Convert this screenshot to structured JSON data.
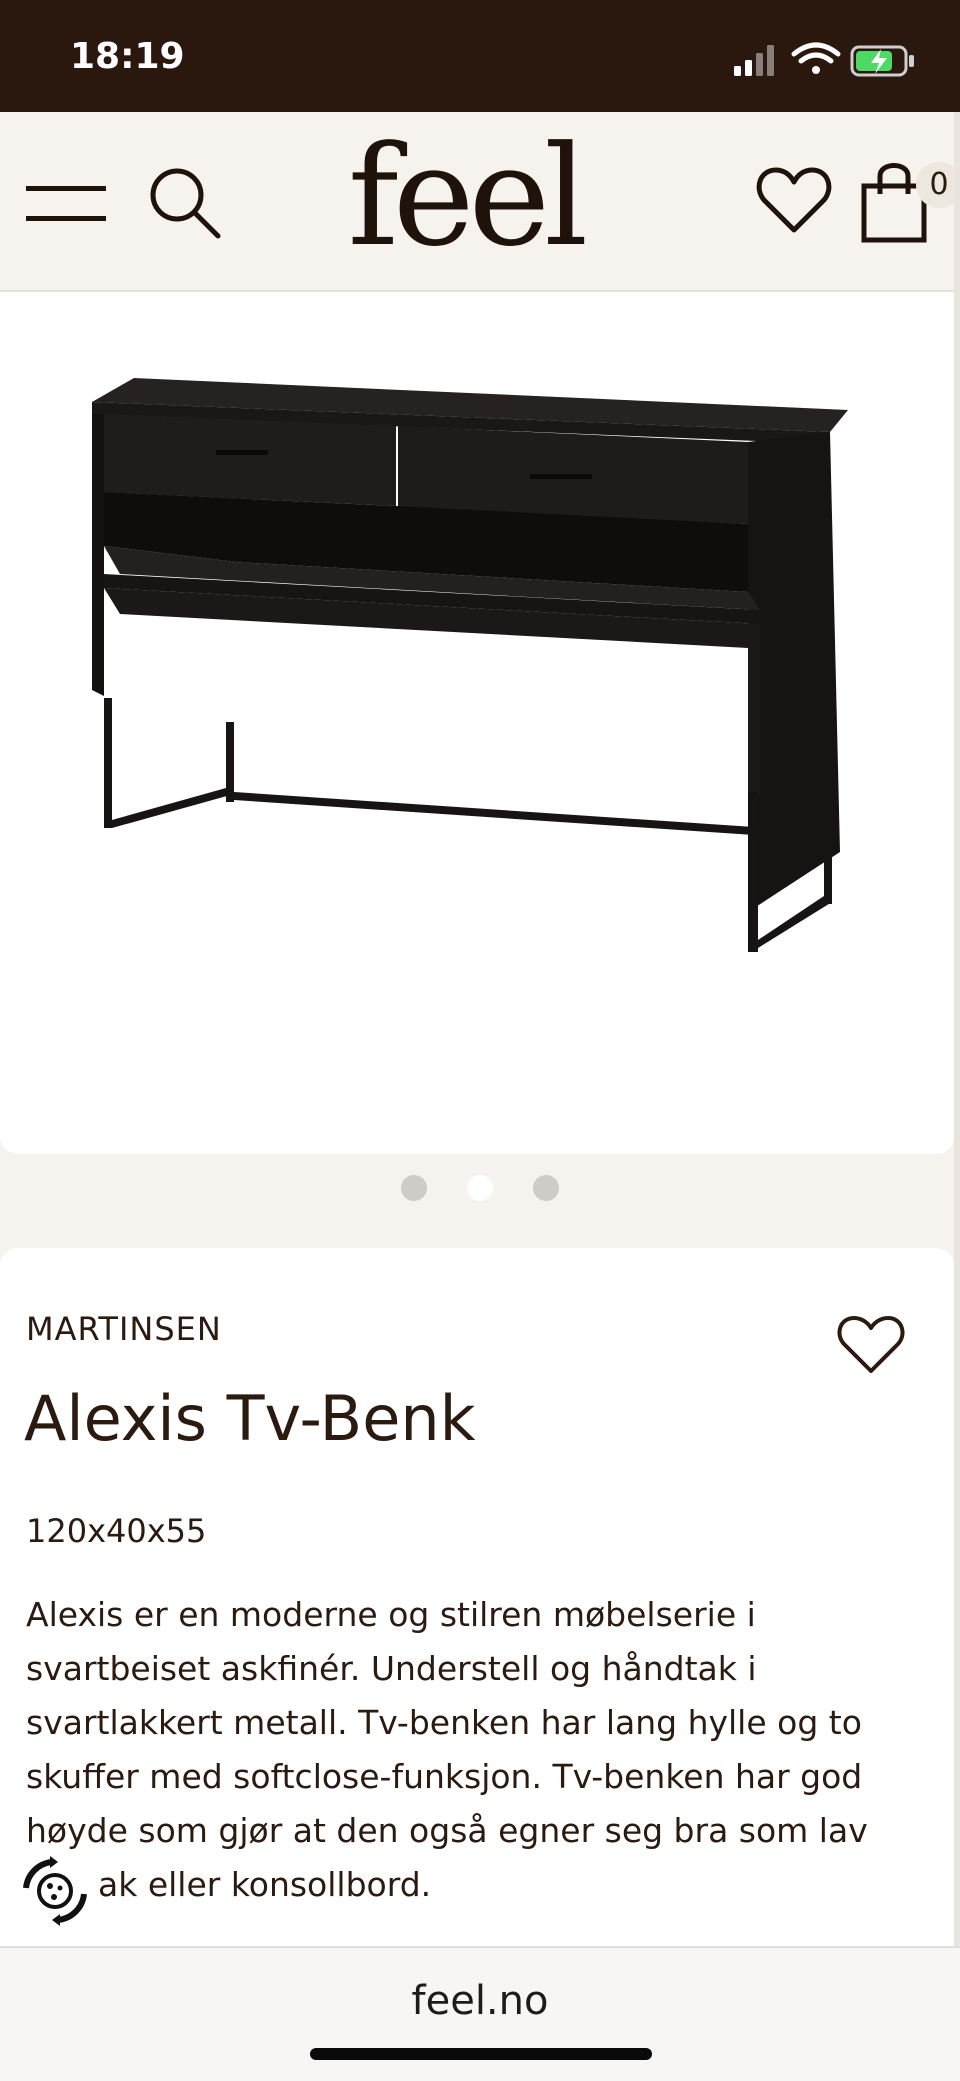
{
  "status_bar": {
    "time": "18:19"
  },
  "header": {
    "logo": "feel",
    "cart_count": "0",
    "icons": [
      "menu-icon",
      "search-icon",
      "heart-icon",
      "shopping-bag-icon"
    ]
  },
  "gallery": {
    "slide_count": 3,
    "active_index": 1
  },
  "product": {
    "brand": "MARTINSEN",
    "title": "Alexis Tv-Benk",
    "dimensions": "120x40x55",
    "description_lines": [
      "Alexis er en moderne og stilren møbelserie i",
      "svartbeiset askfinér. Understell og håndtak i",
      "svartlakkert metall. Tv-benken har lang hylle og to",
      "skuffer med softclose-funksjon. Tv-benken har god",
      "høyde som gjør at den også egner seg bra som lav",
      "ak eller konsollbord."
    ]
  },
  "browser": {
    "url": "feel.no"
  },
  "colors": {
    "status_bar_bg": "#2a170e",
    "page_bg": "#f6f3ee",
    "text": "#2b1a10",
    "furniture": "#1d1a18"
  }
}
